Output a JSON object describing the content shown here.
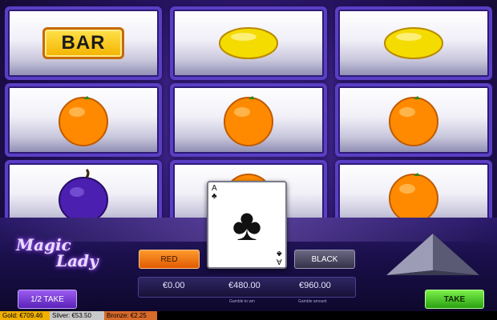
{
  "game": {
    "logo_line1": "Magic",
    "logo_line2": "Lady"
  },
  "reels": {
    "rows": [
      [
        "bar",
        "lemon",
        "lemon"
      ],
      [
        "orange",
        "orange",
        "orange"
      ],
      [
        "plum",
        "orange",
        "orange"
      ]
    ],
    "bar_label": "BAR"
  },
  "gamble": {
    "red_label": "RED",
    "black_label": "BLACK",
    "card": {
      "rank": "A",
      "suit": "♣"
    },
    "amount_left": "€0.00",
    "amount_mid": "€480.00",
    "amount_right": "€960.00",
    "mid_caption": "Gamble to win",
    "right_caption": "Gamble amount"
  },
  "buttons": {
    "half_take": "1/2 TAKE",
    "take": "TAKE"
  },
  "status": {
    "gold": "Gold: €709.46",
    "silver": "Silver: €53.50",
    "bronze": "Bronze: €2.25"
  },
  "colors": {
    "frame": "#5a3fc4",
    "red_button": "#ff9a2e",
    "take_button": "#2aa012"
  }
}
